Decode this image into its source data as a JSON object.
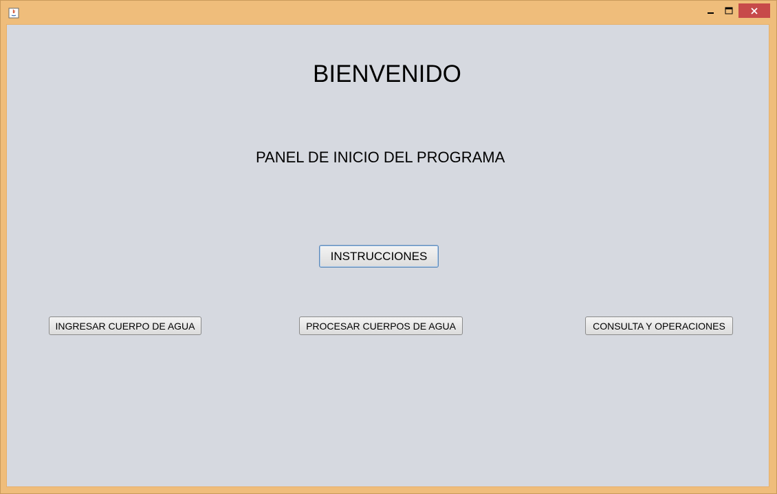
{
  "window": {
    "controls": {
      "minimize_icon": "minimize-icon",
      "maximize_icon": "maximize-icon",
      "close_icon": "close-icon"
    },
    "colors": {
      "frame": "#efbd7b",
      "close_button": "#c74a4a",
      "client_background": "#d6d9e0"
    }
  },
  "main": {
    "title": "BIENVENIDO",
    "subtitle": "PANEL DE INICIO DEL PROGRAMA",
    "instructions_label": "INSTRUCCIONES",
    "buttons": {
      "ingresar": "INGRESAR CUERPO DE AGUA",
      "procesar": "PROCESAR CUERPOS DE AGUA",
      "consulta": "CONSULTA Y OPERACIONES"
    }
  }
}
